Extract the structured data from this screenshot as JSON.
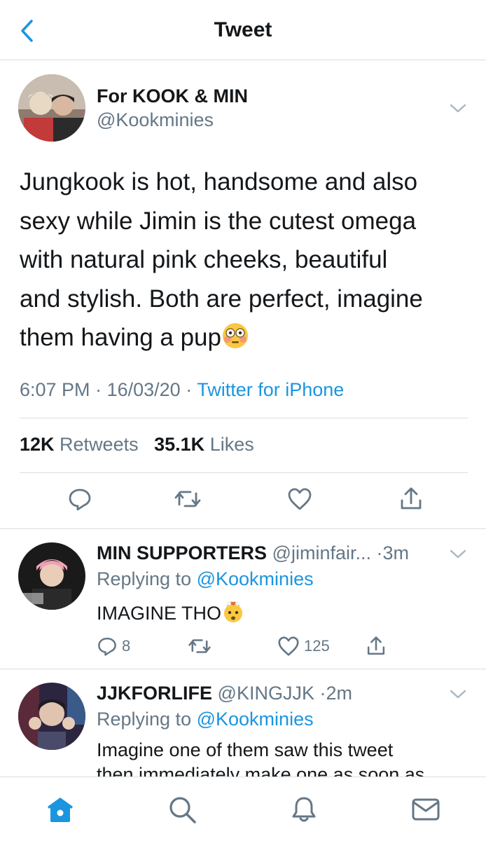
{
  "header": {
    "title": "Tweet"
  },
  "tweet": {
    "display_name": "For KOOK & MIN",
    "handle": "@Kookminies",
    "text_lines": [
      "Jungkook is hot, handsome and also",
      "sexy while Jimin is the cutest omega",
      "with natural pink cheeks, beautiful",
      "and stylish. Both are perfect, imagine",
      "them having a pup"
    ],
    "time": "6:07 PM",
    "date": "16/03/20",
    "source": "Twitter for iPhone",
    "retweets_count": "12K",
    "retweets_label": "Retweets",
    "likes_count": "35.1K",
    "likes_label": "Likes"
  },
  "replies": [
    {
      "display_name": "MIN SUPPORTERS",
      "handle": "@jiminfair...",
      "age": "3m",
      "replying_label": "Replying to",
      "replying_to": "@Kookminies",
      "text": "IMAGINE THO",
      "reply_count": "8",
      "retweet_count": "",
      "like_count": "125"
    },
    {
      "display_name": "JJKFORLIFE",
      "handle": "@KINGJJK",
      "age": "2m",
      "replying_label": "Replying to",
      "replying_to": "@Kookminies",
      "text": "Imagine one of them saw this tweet",
      "text_cut": "then immediately make one as soon as"
    }
  ],
  "tabs": [
    "home-tab",
    "search-tab",
    "notifications-tab",
    "messages-tab"
  ],
  "colors": {
    "accent": "#1b95e0",
    "muted": "#657786",
    "text": "#14171a",
    "border": "#d9dde0"
  }
}
